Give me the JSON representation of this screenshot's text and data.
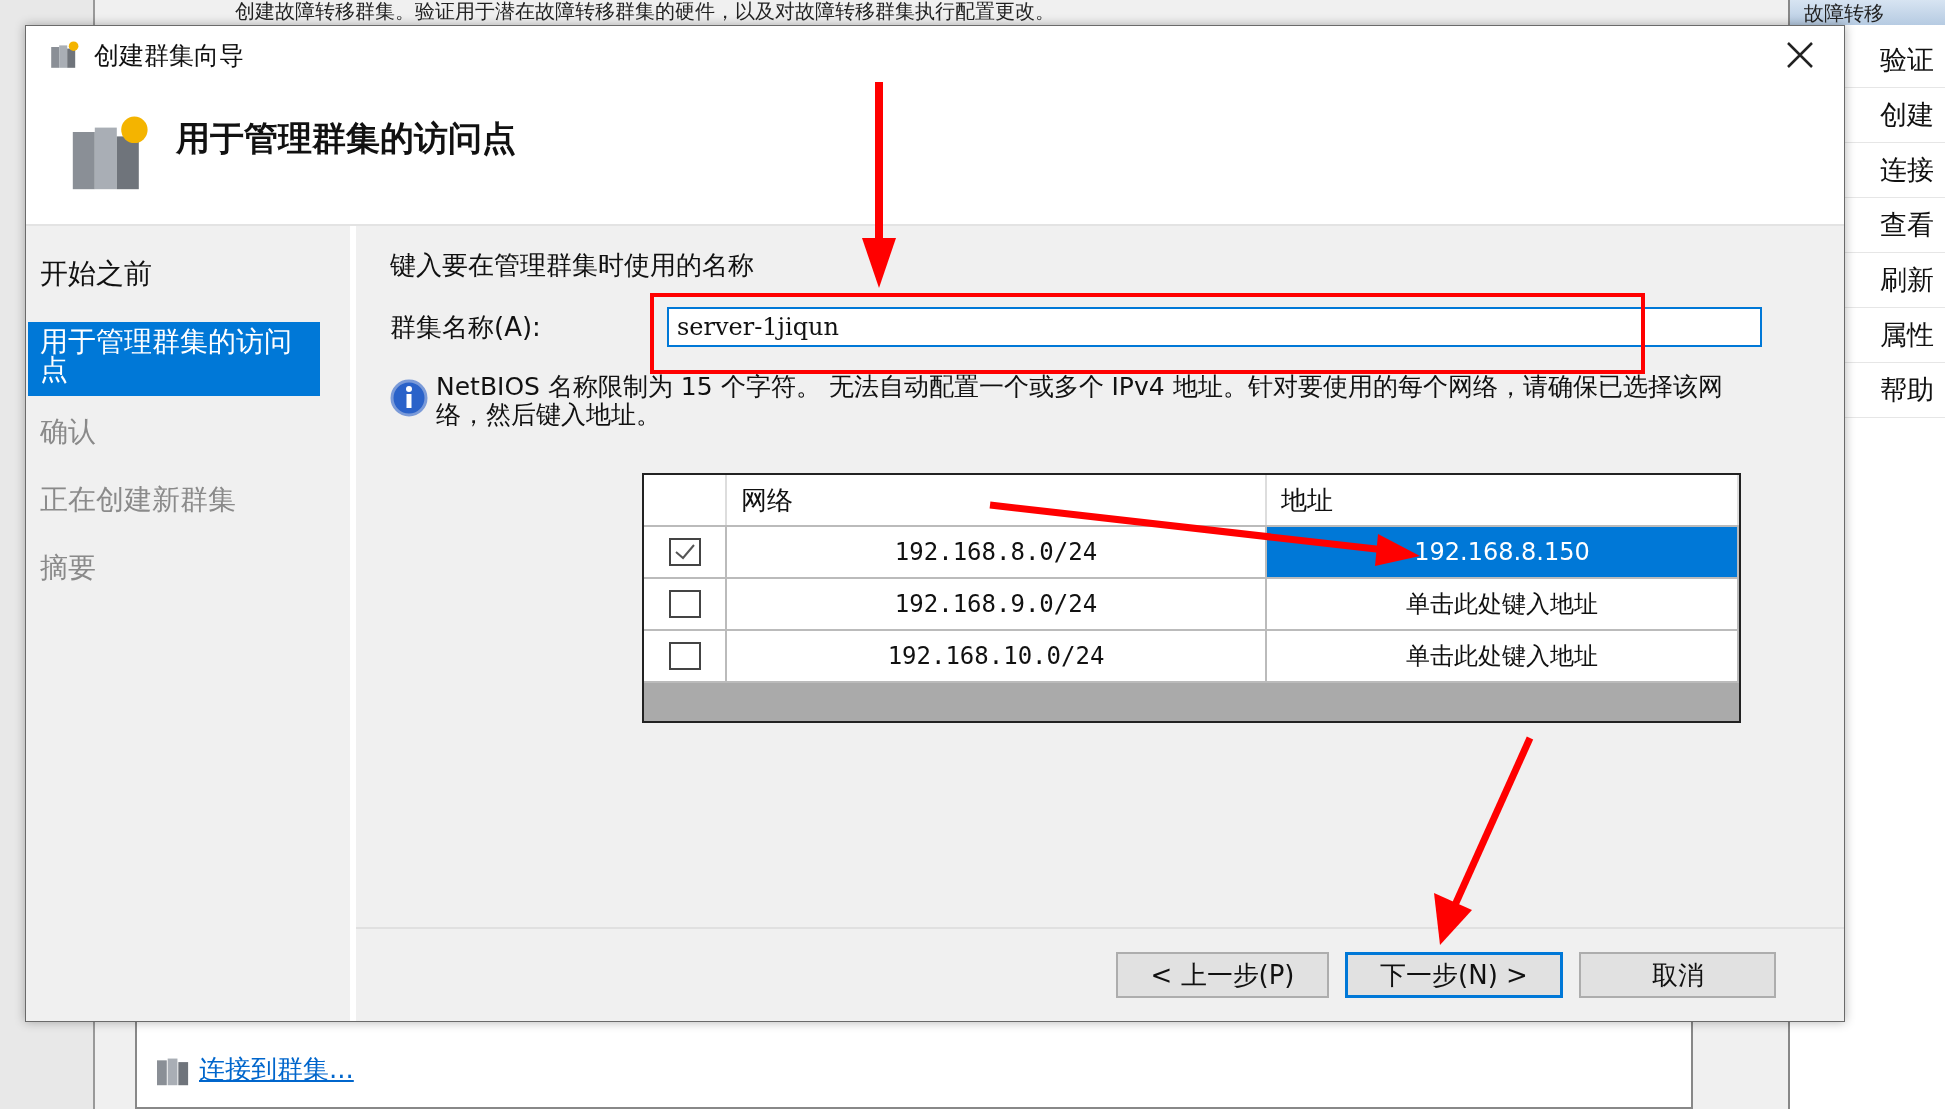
{
  "background": {
    "description": "创建故障转移群集。验证用于潜在故障转移群集的硬件，以及对故障转移群集执行配置更改。",
    "action_pane": {
      "title": "故障转移",
      "items": [
        "验证",
        "创建",
        "连接",
        "查看",
        "刷新",
        "属性",
        "帮助"
      ]
    },
    "link": "连接到群集..."
  },
  "dialog": {
    "title": "创建群集向导",
    "heading": "用于管理群集的访问点",
    "steps": [
      {
        "label": "开始之前",
        "selected": false,
        "disabled": false
      },
      {
        "label": "用于管理群集的访问点",
        "selected": true,
        "disabled": false
      },
      {
        "label": "确认",
        "selected": false,
        "disabled": true
      },
      {
        "label": "正在创建新群集",
        "selected": false,
        "disabled": true
      },
      {
        "label": "摘要",
        "selected": false,
        "disabled": true
      }
    ],
    "prompt": "键入要在管理群集时使用的名称",
    "name_field": {
      "label": "群集名称(A):",
      "value": "server-1jiqun"
    },
    "info": "NetBIOS 名称限制为 15 个字符。 无法自动配置一个或多个 IPv4 地址。针对要使用的每个网络，请确保已选择该网络，然后键入地址。",
    "table": {
      "columns": [
        "网络",
        "地址"
      ],
      "rows": [
        {
          "checked": true,
          "network": "192.168.8.0/24",
          "address": "192.168.8.150",
          "selected": true
        },
        {
          "checked": false,
          "network": "192.168.9.0/24",
          "address": "单击此处键入地址",
          "selected": false
        },
        {
          "checked": false,
          "network": "192.168.10.0/24",
          "address": "单击此处键入地址",
          "selected": false
        }
      ]
    },
    "buttons": [
      {
        "label": "< 上一步(P)",
        "focused": false
      },
      {
        "label": "下一步(N) >",
        "focused": true
      },
      {
        "label": "取消",
        "focused": false
      }
    ]
  }
}
